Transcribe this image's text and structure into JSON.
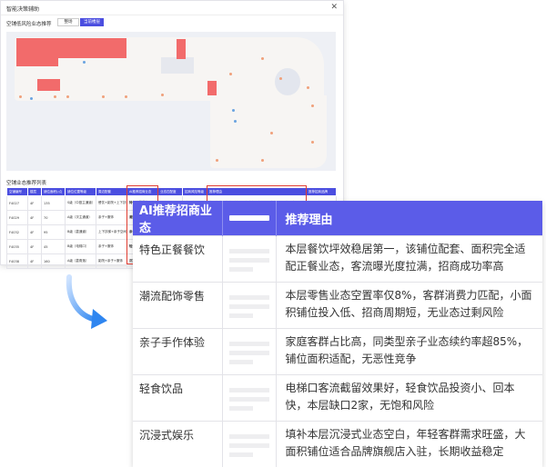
{
  "window": {
    "title": "智能决策辅助",
    "close_icon": "close-icon"
  },
  "map_section": {
    "title": "空铺低风险业态推荐",
    "tabs": [
      {
        "label": "整场",
        "active": false
      },
      {
        "label": "当前楼层",
        "active": true
      }
    ]
  },
  "list_section": {
    "title": "空铺业态推荐列表",
    "headers": [
      "空铺编号",
      "楼层",
      "铺位面积(㎡)",
      "铺位位置等级",
      "周边配套",
      "AI推荐招商业态",
      "业态匹配度",
      "招商风险等级",
      "推荐理由",
      "推荐招商品牌"
    ],
    "rows": [
      [
        "F4027",
        "4F",
        "135",
        "S级（中庭主通道）",
        "餐饮+影院+上下扶梯",
        "特色正餐餐饮",
        "96%",
        "低风险",
        "本层餐饮坪效稳居第一，该铺位配套、面积完全适配正餐业态",
        "精品火锅"
      ],
      [
        "F4029",
        "4F",
        "70",
        "A级（次主通道）",
        "亲子+服饰",
        "潮流配饰零售",
        "",
        "",
        "",
        ""
      ],
      [
        "F4032",
        "4F",
        "95",
        "B级（靠通道）",
        "上下扶梯+亲子空间",
        "亲子手作体验",
        "",
        "",
        "",
        ""
      ],
      [
        "F4035",
        "4F",
        "45",
        "B级（电梯口）",
        "亲子+服饰",
        "轻食饮品",
        "",
        "",
        "",
        ""
      ],
      [
        "F4038",
        "4F",
        "160",
        "A级（靠角落）",
        "影院+亲子+服饰",
        "沉浸式娱乐",
        "",
        "",
        "",
        ""
      ]
    ]
  },
  "overlay": {
    "headers": [
      "AI推荐招商业态",
      "推荐理由"
    ],
    "rows": [
      {
        "category": "特色正餐餐饮",
        "reason": "本层餐饮坪效稳居第一，该铺位配套、面积完全适配正餐业态，客流曝光度拉满，招商成功率高"
      },
      {
        "category": "潮流配饰零售",
        "reason": "本层零售业态空置率仅8%，客群消费力匹配，小面积铺位投入低、招商周期短，无业态过剩风险"
      },
      {
        "category": "亲子手作体验",
        "reason": "家庭客群占比高，同类型亲子业态续约率超85%，铺位面积适配，无恶性竞争"
      },
      {
        "category": "轻食饮品",
        "reason": "电梯口客流截留效果好，轻食饮品投资小、回本快，本层缺口2家，无饱和风险"
      },
      {
        "category": "沉浸式娱乐",
        "reason": "填补本层沉浸式业态空白，年轻客群需求旺盛，大面积铺位适合品牌旗舰店入驻，长期收益稳定"
      }
    ]
  },
  "colors": {
    "accent": "#5b5ce8",
    "highlight_border": "#e03c31",
    "vacant_shop": "#f26b6b"
  }
}
